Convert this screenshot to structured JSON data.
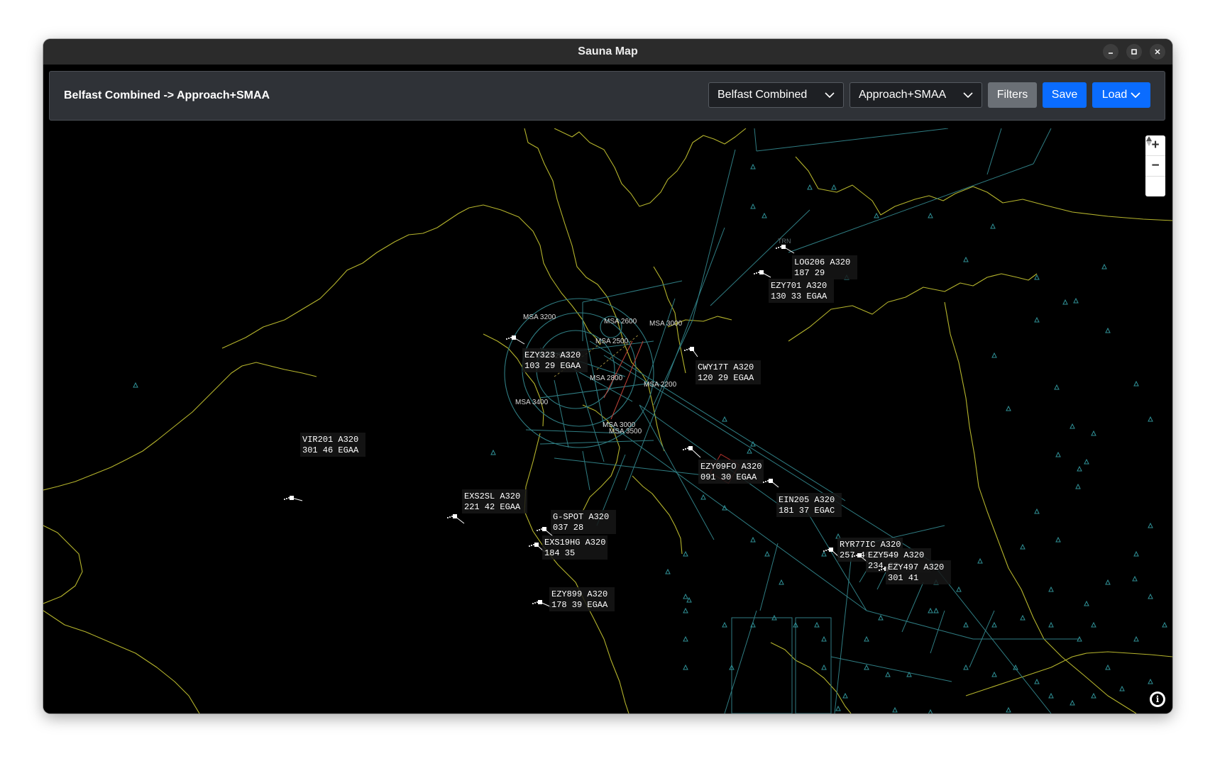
{
  "window": {
    "title": "Sauna Map"
  },
  "toolbar": {
    "breadcrumb": "Belfast Combined -> Approach+SMAA",
    "sector_select": "Belfast Combined",
    "profile_select": "Approach+SMAA",
    "filters_label": "Filters",
    "save_label": "Save",
    "load_label": "Load"
  },
  "map": {
    "colors": {
      "coast": "#b5b42c",
      "airspace": "#2f7d83",
      "fix": "#2f8f95",
      "label": "#ffffff"
    },
    "msa_labels": [
      "MSA 3200",
      "MSA 2600",
      "MSA 3000",
      "MSA 2500",
      "MSA 2000",
      "MSA 2800",
      "MSA 2200",
      "MSA 3400",
      "MSA 3000",
      "MSA 3500"
    ],
    "fix_label": "TRN",
    "aircraft": [
      {
        "callsign": "LOG206 A320",
        "data": "187 29"
      },
      {
        "callsign": "EZY701 A320",
        "data": "130 33 EGAA"
      },
      {
        "callsign": "EZY323 A320",
        "data": "103 29 EGAA"
      },
      {
        "callsign": "CWY17T A320",
        "data": "120 29 EGAA"
      },
      {
        "callsign": "VIR201 A320",
        "data": "301 46 EGAA"
      },
      {
        "callsign": "EZY09FO A320",
        "data": "091 30 EGAA"
      },
      {
        "callsign": "EIN205 A320",
        "data": "181 37 EGAC"
      },
      {
        "callsign": "EXS2SL A320",
        "data": "221 42 EGAA"
      },
      {
        "callsign": "G-SPOT A320",
        "data": "037 28"
      },
      {
        "callsign": "EXS19HG A320",
        "data": "184 35"
      },
      {
        "callsign": "RYR77IC A320",
        "data": "257 46 EGAA"
      },
      {
        "callsign": "EZY549 A320",
        "data": "234 39"
      },
      {
        "callsign": "EZY497 A320",
        "data": "301 41"
      },
      {
        "callsign": "EZY899 A320",
        "data": "178 39 EGAA"
      }
    ]
  }
}
